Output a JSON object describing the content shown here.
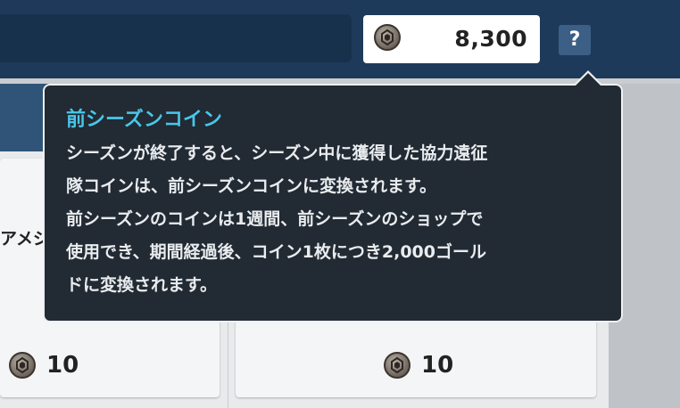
{
  "header": {
    "currency": {
      "icon": "coin-icon",
      "amount": "8,300"
    },
    "help_label": "?"
  },
  "content": {
    "left_partial_label": "アメジ",
    "left_card_price": "10",
    "right_card_price": "10"
  },
  "tooltip": {
    "title": "前シーズンコイン",
    "lines": [
      "シーズンが終了すると、シーズン中に獲得した協力遠征",
      "隊コインは、前シーズンコインに変換されます。",
      "前シーズンのコインは1週間、前シーズンのショップで",
      "使用でき、期間経過後、コイン1枚につき2,000ゴール",
      "ドに変換されます。"
    ]
  },
  "colors": {
    "topbar": "#1e3a5b",
    "tooltip_bg": "#222a33",
    "tooltip_title": "#49c6ea"
  }
}
